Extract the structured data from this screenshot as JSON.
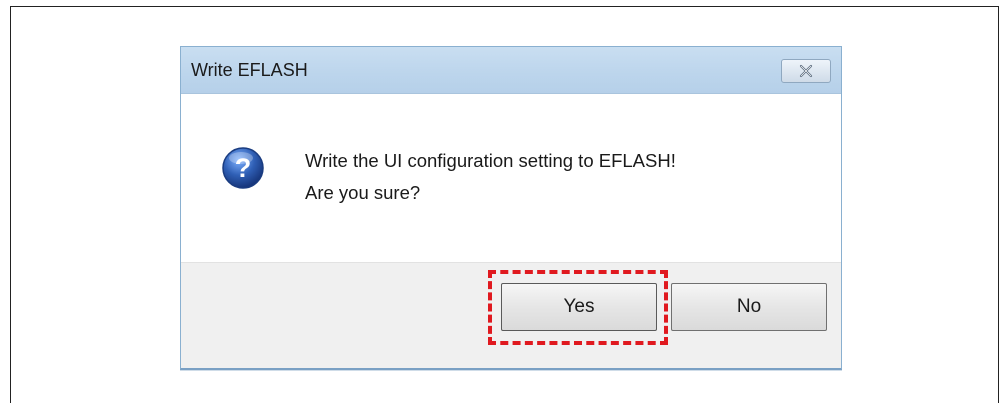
{
  "dialog": {
    "title": "Write EFLASH",
    "message_line1": "Write the UI configuration setting to EFLASH!",
    "message_line2": "Are you sure?",
    "icon": "question-icon",
    "buttons": {
      "yes_label": "Yes",
      "no_label": "No"
    },
    "highlighted_button": "Yes"
  },
  "colors": {
    "titlebar": "#bcd5ec",
    "footer": "#f0f0f0",
    "highlight": "#e0191f",
    "icon_blue": "#2f5fb5"
  }
}
